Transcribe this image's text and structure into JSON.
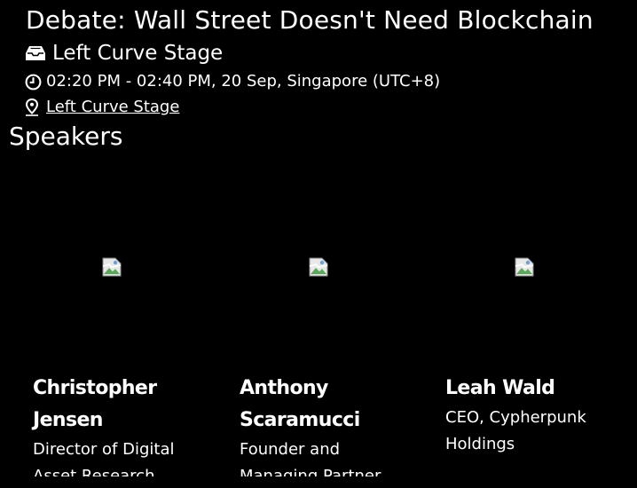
{
  "event": {
    "title": "Debate: Wall Street Doesn't Need Blockchain",
    "stage": "Left Curve Stage",
    "time": "02:20 PM - 02:40 PM, 20 Sep, Singapore (UTC+8)",
    "location_link": "Left Curve Stage"
  },
  "speakers_section": {
    "heading": "Speakers",
    "speakers": [
      {
        "name": "Christopher Jensen",
        "role": "Director of Digital Asset Research"
      },
      {
        "name": "Anthony Scaramucci",
        "role": "Founder and Managing Partner"
      },
      {
        "name": "Leah Wald",
        "role": "CEO, Cypherpunk Holdings"
      }
    ]
  },
  "icons": {
    "stage": "inbox-tray-icon",
    "time": "clock-icon",
    "location": "map-pin-icon",
    "photo": "broken-image-icon"
  },
  "colors": {
    "background": "#000000",
    "text": "#ffffff"
  }
}
